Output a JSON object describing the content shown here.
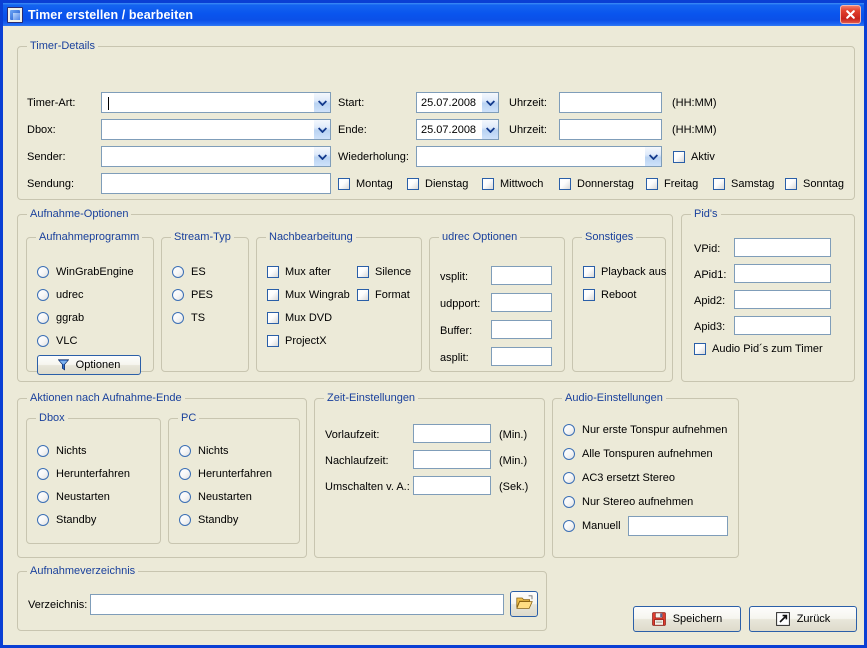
{
  "window": {
    "title": "Timer erstellen / bearbeiten",
    "icon": "app-window-icon",
    "close_label": "✕",
    "accent_title_bar": "#0a55ee",
    "accent_group_title": "#19409c",
    "background": "#ecead8"
  },
  "timer_details": {
    "legend": "Timer-Details",
    "labels": {
      "timer_art": "Timer-Art:",
      "dbox": "Dbox:",
      "sender": "Sender:",
      "sendung": "Sendung:",
      "start": "Start:",
      "ende": "Ende:",
      "uhrzeit": "Uhrzeit:",
      "wiederholung": "Wiederholung:",
      "hhmm": "(HH:MM)"
    },
    "values": {
      "timer_art": "",
      "dbox": "",
      "sender": "",
      "sendung": "",
      "start_date": "25.07.2008",
      "ende_date": "25.07.2008",
      "start_time": "",
      "ende_time": "",
      "wiederholung": ""
    },
    "aktiv": {
      "label": "Aktiv",
      "checked": false
    },
    "weekdays": [
      {
        "label": "Montag",
        "checked": false
      },
      {
        "label": "Dienstag",
        "checked": false
      },
      {
        "label": "Mittwoch",
        "checked": false
      },
      {
        "label": "Donnerstag",
        "checked": false
      },
      {
        "label": "Freitag",
        "checked": false
      },
      {
        "label": "Samstag",
        "checked": false
      },
      {
        "label": "Sonntag",
        "checked": false
      }
    ]
  },
  "aufnahme_optionen": {
    "legend": "Aufnahme-Optionen",
    "aufnahmeprogramm": {
      "legend": "Aufnahmeprogramm",
      "options": [
        {
          "label": "WinGrabEngine",
          "selected": false
        },
        {
          "label": "udrec",
          "selected": false
        },
        {
          "label": "ggrab",
          "selected": false
        },
        {
          "label": "VLC",
          "selected": false
        }
      ],
      "button": {
        "label": "Optionen",
        "icon": "filter-funnel-icon"
      }
    },
    "stream_typ": {
      "legend": "Stream-Typ",
      "options": [
        {
          "label": "ES",
          "selected": false
        },
        {
          "label": "PES",
          "selected": false
        },
        {
          "label": "TS",
          "selected": false
        }
      ]
    },
    "nachbearbeitung": {
      "legend": "Nachbearbeitung",
      "col1": [
        {
          "label": "Mux after",
          "checked": false
        },
        {
          "label": "Mux Wingrab",
          "checked": false
        },
        {
          "label": "Mux DVD",
          "checked": false
        },
        {
          "label": "ProjectX",
          "checked": false
        }
      ],
      "col2": [
        {
          "label": "Silence",
          "checked": false
        },
        {
          "label": "Format",
          "checked": false
        }
      ]
    },
    "udrec_optionen": {
      "legend": "udrec Optionen",
      "fields": [
        {
          "label": "vsplit:",
          "value": ""
        },
        {
          "label": "udpport:",
          "value": ""
        },
        {
          "label": "Buffer:",
          "value": ""
        },
        {
          "label": "asplit:",
          "value": ""
        }
      ]
    },
    "sonstiges": {
      "legend": "Sonstiges",
      "options": [
        {
          "label": "Playback aus",
          "checked": false
        },
        {
          "label": "Reboot",
          "checked": false
        }
      ]
    },
    "pids": {
      "legend": "Pid's",
      "fields": [
        {
          "label": "VPid:",
          "value": ""
        },
        {
          "label": "APid1:",
          "value": ""
        },
        {
          "label": "Apid2:",
          "value": ""
        },
        {
          "label": "Apid3:",
          "value": ""
        }
      ],
      "checkbox": {
        "label": "Audio Pid´s zum Timer",
        "checked": false
      }
    }
  },
  "aktionen": {
    "legend": "Aktionen nach Aufnahme-Ende",
    "dbox": {
      "legend": "Dbox",
      "options": [
        {
          "label": "Nichts",
          "selected": false
        },
        {
          "label": "Herunterfahren",
          "selected": false
        },
        {
          "label": "Neustarten",
          "selected": false
        },
        {
          "label": "Standby",
          "selected": false
        }
      ]
    },
    "pc": {
      "legend": "PC",
      "options": [
        {
          "label": "Nichts",
          "selected": false
        },
        {
          "label": "Herunterfahren",
          "selected": false
        },
        {
          "label": "Neustarten",
          "selected": false
        },
        {
          "label": "Standby",
          "selected": false
        }
      ]
    }
  },
  "zeit_einstellungen": {
    "legend": "Zeit-Einstellungen",
    "rows": [
      {
        "label": "Vorlaufzeit:",
        "value": "",
        "unit": "(Min.)"
      },
      {
        "label": "Nachlaufzeit:",
        "value": "",
        "unit": "(Min.)"
      },
      {
        "label": "Umschalten v. A.:",
        "value": "",
        "unit": "(Sek.)"
      }
    ]
  },
  "audio_einstellungen": {
    "legend": "Audio-Einstellungen",
    "options": [
      {
        "label": "Nur erste Tonspur aufnehmen",
        "selected": false
      },
      {
        "label": "Alle Tonspuren aufnehmen",
        "selected": false
      },
      {
        "label": "AC3 ersetzt Stereo",
        "selected": false
      },
      {
        "label": "Nur Stereo aufnehmen",
        "selected": false
      },
      {
        "label": "Manuell",
        "selected": false
      }
    ],
    "manuell_value": ""
  },
  "aufnahmeverzeichnis": {
    "legend": "Aufnahmeverzeichnis",
    "label": "Verzeichnis:",
    "value": "",
    "browse_icon": "open-folder-icon"
  },
  "footer": {
    "save": {
      "label": "Speichern",
      "icon": "floppy-disk-icon"
    },
    "back": {
      "label": "Zurück",
      "icon": "arrow-up-right-icon"
    }
  }
}
